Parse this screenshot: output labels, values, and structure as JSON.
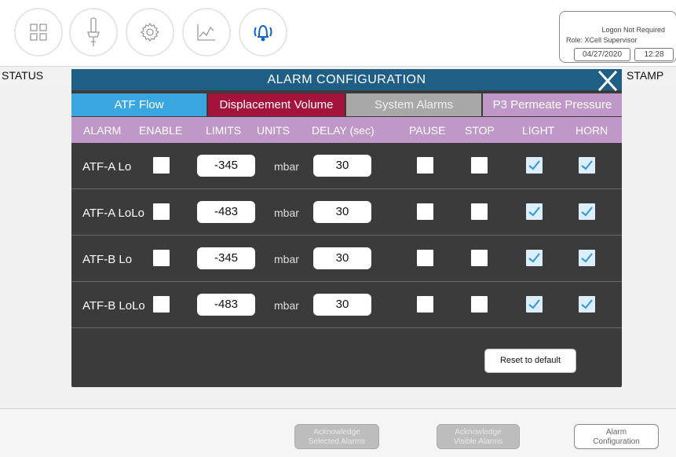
{
  "nav": {
    "items": [
      {
        "name": "grid-icon"
      },
      {
        "name": "probe-icon"
      },
      {
        "name": "gear-icon"
      },
      {
        "name": "chart-icon"
      },
      {
        "name": "alarm-bell-icon"
      }
    ],
    "active_color": "#1565c0"
  },
  "logon": {
    "title": "Logon Not Required",
    "role": "Role: XCell Supervisor",
    "date": "04/27/2020",
    "time": "12:28"
  },
  "background": {
    "status_header": "STATUS",
    "stamp_header": "STAMP"
  },
  "modal": {
    "title": "ALARM  CONFIGURATION",
    "tabs": [
      {
        "label": "ATF Flow",
        "bg": "#3aa6e0",
        "fg": "#ffffff"
      },
      {
        "label": "Displacement Volume",
        "bg": "#a4133c",
        "fg": "#ffffff"
      },
      {
        "label": "System Alarms",
        "bg": "#a8a8a8",
        "fg": "#f0f0f0"
      },
      {
        "label": "P3 Permeate Pressure",
        "bg": "#c098c8",
        "fg": "#ffffff"
      }
    ],
    "columns": [
      "ALARM",
      "ENABLE",
      "LIMITS",
      "UNITS",
      "DELAY (sec)",
      "PAUSE",
      "STOP",
      "LIGHT",
      "HORN"
    ],
    "rows": [
      {
        "name": "ATF-A Lo",
        "limit": "-345",
        "unit": "mbar",
        "delay": "30"
      },
      {
        "name": "ATF-A LoLo",
        "limit": "-483",
        "unit": "mbar",
        "delay": "30"
      },
      {
        "name": "ATF-B Lo",
        "limit": "-345",
        "unit": "mbar",
        "delay": "30"
      },
      {
        "name": "ATF-B LoLo",
        "limit": "-483",
        "unit": "mbar",
        "delay": "30"
      }
    ],
    "reset_label": "Reset to default"
  },
  "bottom": {
    "ack_selected": "Acknowledge\nSelected Alarms",
    "ack_visible": "Acknowledge\nVisible Alarms",
    "alarm_config": "Alarm\nConfiguration"
  }
}
